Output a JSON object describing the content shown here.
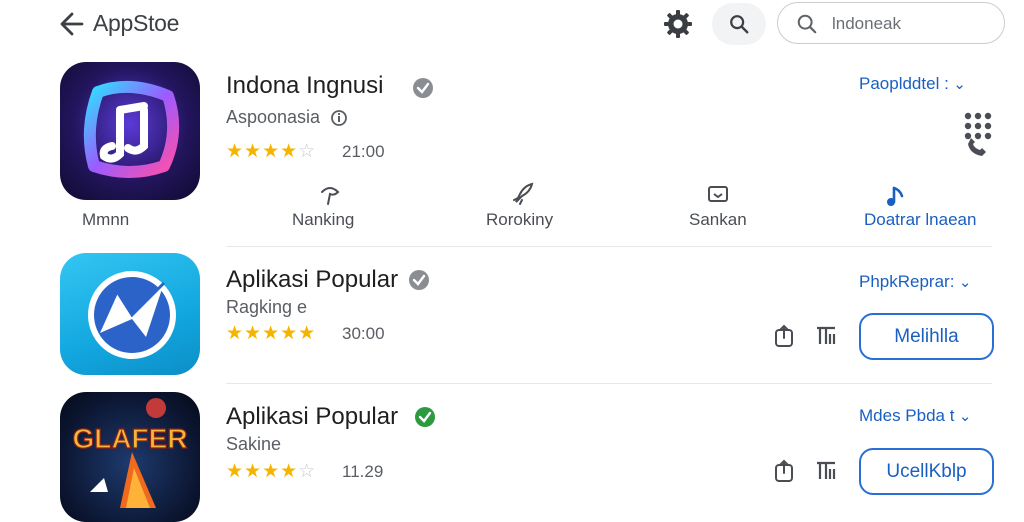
{
  "header": {
    "title": "AppStoe",
    "search_placeholder": "lndoneak"
  },
  "apps": [
    {
      "name": "Indona Ingnusi",
      "developer": "Aspoonasia",
      "stars": 3.5,
      "rating_text": "21:00",
      "dropdown_label": "Paoplddtel :",
      "verified_color": "#8a8d91"
    },
    {
      "name": "Aplikasi Popular",
      "developer": "Ragking e",
      "stars": 5,
      "rating_text": "30:00",
      "dropdown_label": "PhpkReprar:",
      "button_label": "Melihlla",
      "verified_color": "#8a8d91"
    },
    {
      "name": "Aplikasi Popular",
      "developer": "Sakine",
      "stars": 4.5,
      "rating_text": "11.29",
      "dropdown_label": "Mdes Pbda t",
      "button_label": "UcellKblp",
      "verified_color": "#2e9a3f",
      "icon_text": "GLAFER"
    }
  ],
  "tabs": [
    {
      "label": "Mmnn"
    },
    {
      "label": "Nanking"
    },
    {
      "label": "Rorokiny"
    },
    {
      "label": "Sankan"
    },
    {
      "label": "Doatrar lnaean",
      "active": true
    }
  ],
  "icon_app3_text": "GLAFER"
}
